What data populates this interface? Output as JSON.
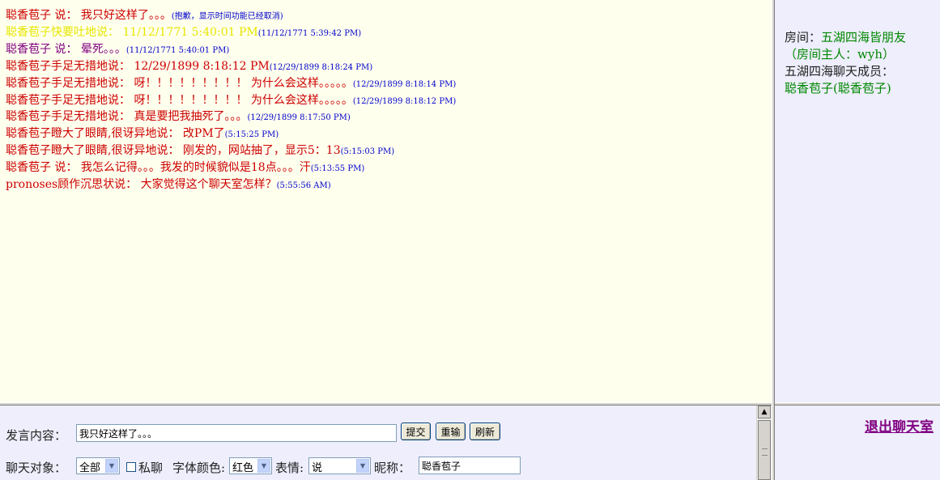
{
  "messages": [
    {
      "text": "聪香苞子  说：  我只好这样了。。。",
      "ts": "(抱歉，显示时间功能已经取消)",
      "color": "red"
    },
    {
      "text": "聪香苞子快要吐地说：  11/12/1771 5:40:01 PM",
      "ts": "(11/12/1771 5:39:42 PM)",
      "color": "yellow"
    },
    {
      "text": "聪香苞子  说：  晕死。。。",
      "ts": "(11/12/1771 5:40:01 PM)",
      "color": "purple"
    },
    {
      "text": "聪香苞子手足无措地说：  12/29/1899 8:18:12 PM",
      "ts": "(12/29/1899 8:18:24 PM)",
      "color": "red"
    },
    {
      "text": "聪香苞子手足无措地说：  呀！！！！！！！！！ 为什么会这样。。。。。",
      "ts": "(12/29/1899 8:18:14 PM)",
      "color": "red"
    },
    {
      "text": "聪香苞子手足无措地说：  呀！！！！！！！！！ 为什么会这样。。。。。",
      "ts": "(12/29/1899 8:18:12 PM)",
      "color": "red"
    },
    {
      "text": "聪香苞子手足无措地说：  真是要把我抽死了。。。",
      "ts": "(12/29/1899 8:17:50 PM)",
      "color": "red"
    },
    {
      "text": "聪香苞子瞪大了眼睛,很讶异地说：  改PM了",
      "ts": "(5:15:25 PM)",
      "color": "red"
    },
    {
      "text": "聪香苞子瞪大了眼睛,很讶异地说：  刚发的，网站抽了，显示5：13",
      "ts": "(5:15:03 PM)",
      "color": "red"
    },
    {
      "text": "聪香苞子  说：  我怎么记得。。。我发的时候貌似是18点。。。汗",
      "ts": "(5:13:55 PM)",
      "color": "red"
    },
    {
      "text": "pronoses顾作沉思状说：  大家觉得这个聊天室怎样？",
      "ts": "(5:55:56 AM)",
      "color": "red"
    }
  ],
  "room": {
    "label": "房间：",
    "name": "五湖四海皆朋友",
    "host": "（房间主人：wyh）",
    "members_label": "五湖四海聊天成员：",
    "members": [
      "聪香苞子(聪香苞子)"
    ]
  },
  "form": {
    "speak_label": "发言内容：",
    "speak_value": "我只好这样了。。。",
    "submit": "提交",
    "reset": "重输",
    "refresh": "刷新",
    "target_label": "聊天对象：",
    "target_value": "全部",
    "private_label": "私聊",
    "color_label": "字体颜色:",
    "color_value": "红色",
    "emotion_label": "表情:",
    "emotion_value": "说",
    "nick_label": "昵称：",
    "nick_value": "聪香苞子"
  },
  "quit": "退出聊天室",
  "colors": {
    "red": "#cc0000",
    "purple": "#800080",
    "yellow": "#e6e600",
    "timestamp": "#0000cc",
    "member": "#008800"
  }
}
